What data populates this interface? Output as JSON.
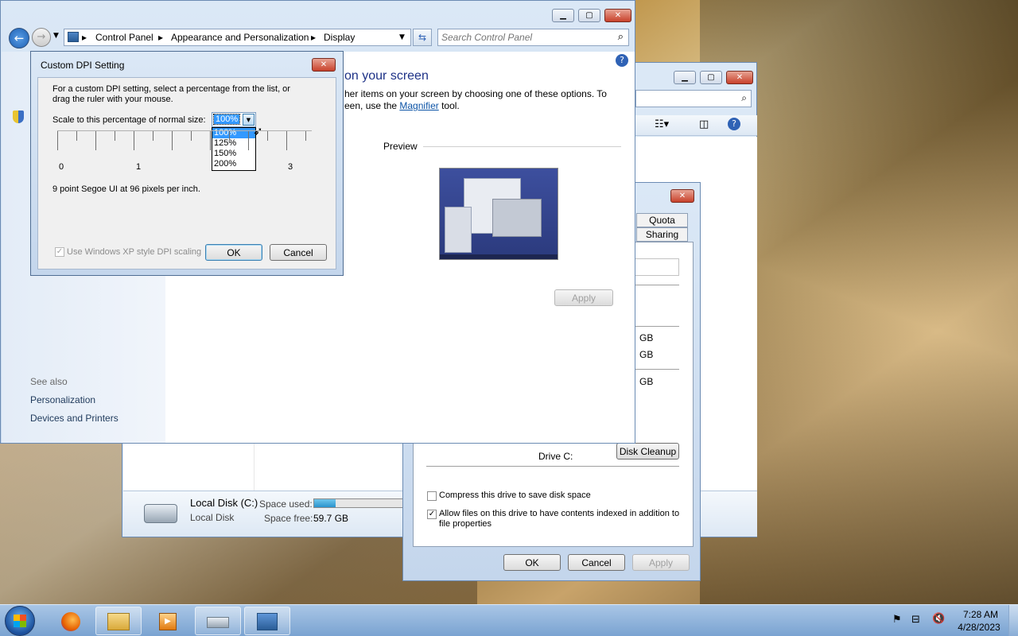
{
  "control_panel": {
    "breadcrumb": [
      "Control Panel",
      "Appearance and Personalization",
      "Display"
    ],
    "search_placeholder": "Search Control Panel",
    "heading_partial": "on your screen",
    "desc_line1": "her items on your screen by choosing one of these options. To",
    "desc_line2_prefix": "een, use the ",
    "desc_link": "Magnifier",
    "desc_line2_suffix": " tool.",
    "preview_label": "Preview",
    "apply_label": "Apply",
    "see_also_label": "See also",
    "see_also_links": [
      "Personalization",
      "Devices and Printers"
    ]
  },
  "dpi_dialog": {
    "title": "Custom DPI Setting",
    "instructions_line1": "For a custom DPI setting, select a percentage from the list, or",
    "instructions_line2": "drag the ruler with your mouse.",
    "scale_label": "Scale to this percentage of normal size:",
    "selected_value": "100%",
    "options": [
      "100%",
      "125%",
      "150%",
      "200%"
    ],
    "ruler_labels": [
      "0",
      "1",
      "3"
    ],
    "font_info": "9 point Segoe UI at 96 pixels per inch.",
    "xp_scaling_label": "Use Windows XP style DPI scaling",
    "ok_label": "OK",
    "cancel_label": "Cancel"
  },
  "properties_dialog": {
    "tabs": [
      "Quota",
      "Sharing"
    ],
    "gb_values": [
      "GB",
      "GB",
      "GB"
    ],
    "drive_label": "Drive C:",
    "disk_cleanup_label": "Disk Cleanup",
    "compress_label": "Compress this drive to save disk space",
    "index_label_line1": "Allow files on this drive to have contents indexed in addition to",
    "index_label_line2": "file properties",
    "ok_label": "OK",
    "cancel_label": "Cancel",
    "apply_label": "Apply"
  },
  "explorer_window": {
    "drive_name": "Local Disk (C:)",
    "drive_type": "Local Disk",
    "space_used_label": "Space used:",
    "space_free_label": "Space free:",
    "space_free_value": "59.7 GB",
    "space_used_fraction": 0.23
  },
  "taskbar": {
    "time": "7:28 AM",
    "date": "4/28/2023"
  },
  "colors": {
    "accent": "#0b53a6",
    "selection": "#3399ff"
  }
}
